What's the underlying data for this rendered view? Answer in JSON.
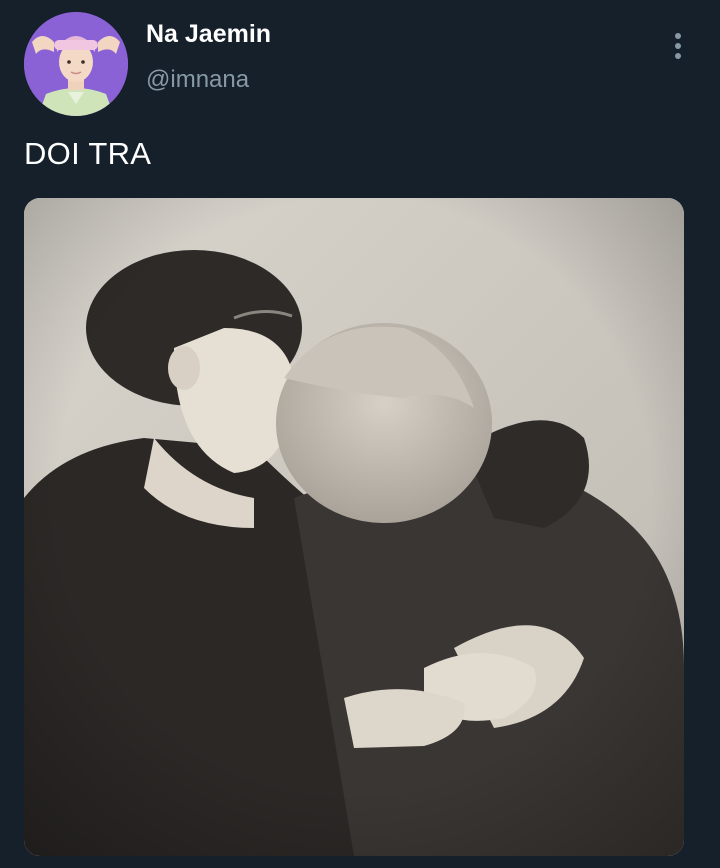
{
  "tweet": {
    "author": {
      "display_name": "Na Jaemin",
      "handle": "@imnana",
      "avatar_icon": "profile-photo"
    },
    "text": "DOI TRA",
    "more_icon": "vertical-ellipsis-icon",
    "media": {
      "type": "photo",
      "tone": "sepia black-and-white"
    }
  },
  "colors": {
    "background": "#15202b",
    "primary_text": "#ffffff",
    "secondary_text": "#8899a6"
  }
}
